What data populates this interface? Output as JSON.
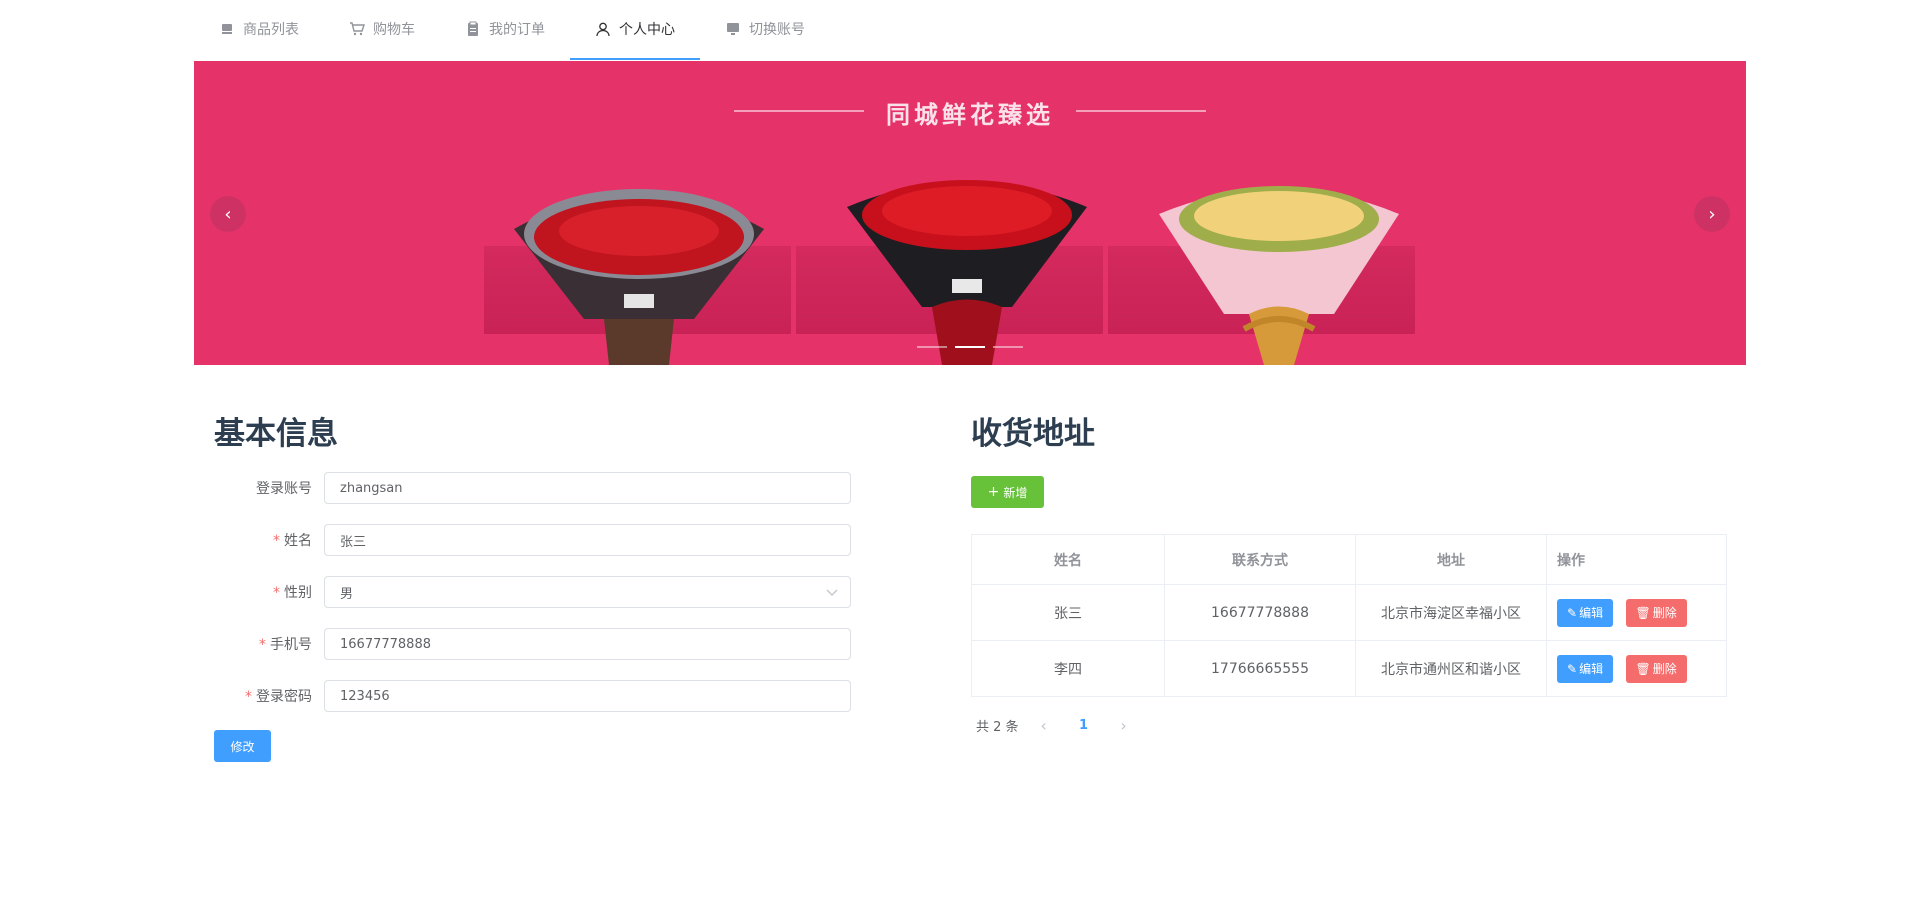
{
  "nav": {
    "items": [
      {
        "label": "商品列表",
        "icon": "goods-icon"
      },
      {
        "label": "购物车",
        "icon": "shopping-cart-icon"
      },
      {
        "label": "我的订单",
        "icon": "order-icon"
      },
      {
        "label": "个人中心",
        "icon": "user-icon"
      },
      {
        "label": "切换账号",
        "icon": "monitor-icon"
      }
    ],
    "active": "个人中心"
  },
  "banner": {
    "headline": "同城鲜花臻选",
    "prev": "‹",
    "next": "›",
    "active_indicator": 2
  },
  "basic_info": {
    "title": "基本信息",
    "fields": [
      {
        "label": "登录账号",
        "value": "zhangsan",
        "required": false
      },
      {
        "label": "姓名",
        "value": "张三",
        "required": true
      },
      {
        "label": "性别",
        "value": "男",
        "required": true
      },
      {
        "label": "手机号",
        "value": "16677778888",
        "required": true
      },
      {
        "label": "登录密码",
        "value": "123456",
        "required": true
      }
    ],
    "submit_label": "修改"
  },
  "address": {
    "title": "收货地址",
    "add_label": "新增",
    "columns": [
      "姓名",
      "联系方式",
      "地址",
      "操作"
    ],
    "rows": [
      {
        "name": "张三",
        "phone": "16677778888",
        "address": "北京市海淀区幸福小区"
      },
      {
        "name": "李四",
        "phone": "17766665555",
        "address": "北京市通州区和谐小区"
      }
    ],
    "edit_label": "编辑",
    "delete_label": "删除",
    "pager": {
      "total_text": "共 2 条",
      "current_page": "1",
      "prev": "‹",
      "next": "›"
    }
  },
  "colors": {
    "primary": "#409eff",
    "success": "#67c23a",
    "danger": "#f56c6c",
    "banner_bg": "#e5336a"
  }
}
